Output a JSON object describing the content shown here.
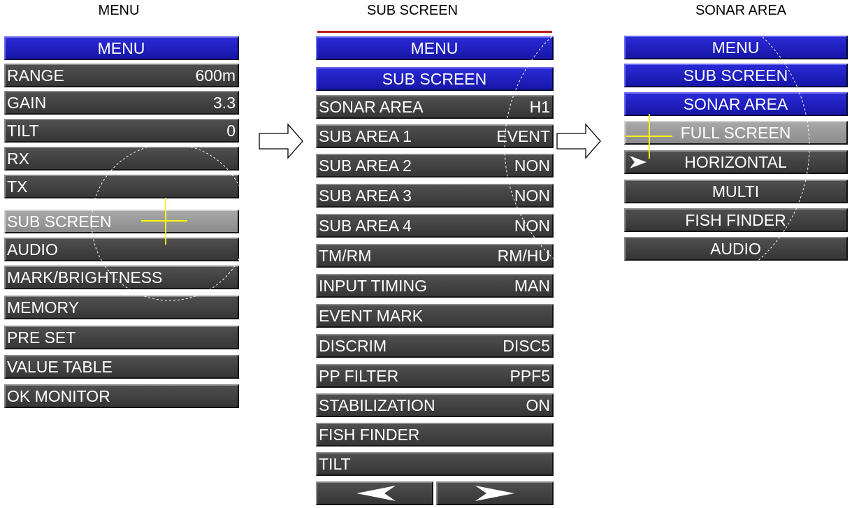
{
  "captions": {
    "left": "MENU",
    "middle": "SUB SCREEN",
    "right": "SONAR AREA"
  },
  "menu": {
    "title": "MENU",
    "items": [
      {
        "label": "RANGE",
        "value": "600m"
      },
      {
        "label": "GAIN",
        "value": "3.3"
      },
      {
        "label": "TILT",
        "value": "0"
      },
      {
        "label": "RX",
        "value": ""
      },
      {
        "label": "TX",
        "value": ""
      },
      {
        "label": "SUB SCREEN",
        "value": "",
        "selected": true
      },
      {
        "label": "AUDIO",
        "value": ""
      },
      {
        "label": "MARK/BRIGHTNESS",
        "value": ""
      },
      {
        "label": "MEMORY",
        "value": ""
      },
      {
        "label": "PRE SET",
        "value": ""
      },
      {
        "label": "VALUE TABLE",
        "value": ""
      },
      {
        "label": "OK MONITOR",
        "value": ""
      }
    ]
  },
  "sub_screen": {
    "breadcrumb": [
      "MENU",
      "SUB SCREEN"
    ],
    "items": [
      {
        "label": "SONAR AREA",
        "value": "H1"
      },
      {
        "label": "SUB AREA 1",
        "value": "EVENT"
      },
      {
        "label": "SUB AREA 2",
        "value": "NON"
      },
      {
        "label": "SUB AREA 3",
        "value": "NON"
      },
      {
        "label": "SUB AREA 4",
        "value": "NON"
      },
      {
        "label": "TM/RM",
        "value": "RM/HU"
      },
      {
        "label": "INPUT TIMING",
        "value": "MAN"
      },
      {
        "label": "EVENT MARK",
        "value": ""
      },
      {
        "label": "DISCRIM",
        "value": "DISC5"
      },
      {
        "label": "PP FILTER",
        "value": "PPF5"
      },
      {
        "label": "STABILIZATION",
        "value": "ON"
      },
      {
        "label": "FISH FINDER",
        "value": ""
      },
      {
        "label": "TILT",
        "value": ""
      }
    ],
    "nav": {
      "prev_icon": "arrow-left-icon",
      "next_icon": "arrow-right-icon"
    }
  },
  "sonar_area": {
    "breadcrumb": [
      "MENU",
      "SUB SCREEN",
      "SONAR AREA"
    ],
    "options": [
      {
        "label": "FULL SCREEN",
        "selected": true
      },
      {
        "label": "HORIZONTAL",
        "current": true
      },
      {
        "label": "MULTI"
      },
      {
        "label": "FISH FINDER"
      },
      {
        "label": "AUDIO"
      }
    ]
  },
  "colors": {
    "header_blue": "#1f1fc4",
    "row_gray": "#444444",
    "selected_gray": "#9a9a9a",
    "cursor_yellow": "#ffff00"
  }
}
